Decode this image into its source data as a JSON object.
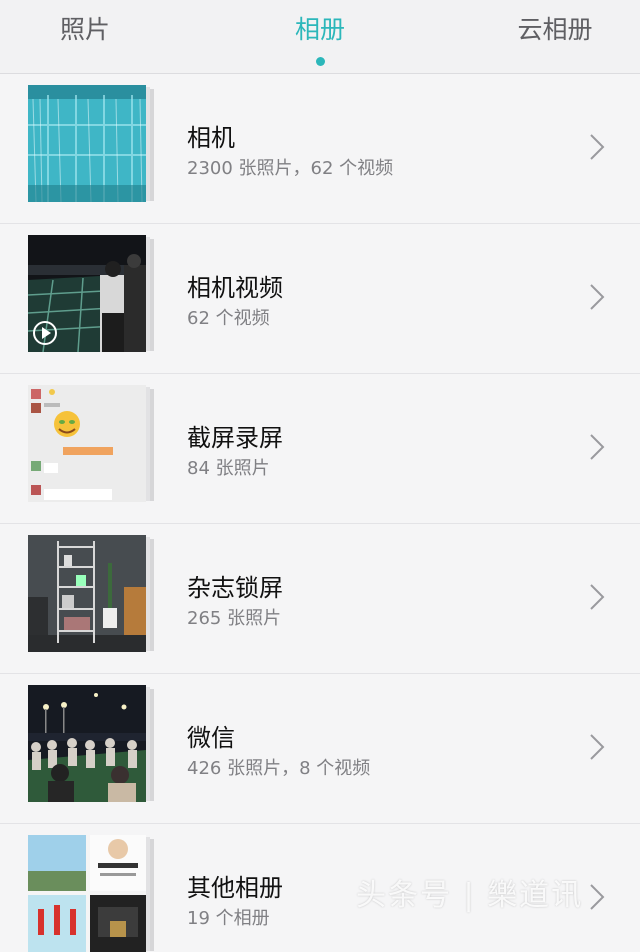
{
  "tabs": [
    {
      "label": "照片"
    },
    {
      "label": "相册"
    },
    {
      "label": "云相册"
    }
  ],
  "active_tab_color": "#2cb7ba",
  "albums": [
    {
      "title": "相机",
      "subtitle": "2300 张照片，62 个视频",
      "thumb_icon": "window-curtain-photo"
    },
    {
      "title": "相机视频",
      "subtitle": "62 个视频",
      "thumb_icon": "night-video-thumbnail"
    },
    {
      "title": "截屏录屏",
      "subtitle": "84 张照片",
      "thumb_icon": "chat-screenshot-thumbnail"
    },
    {
      "title": "杂志锁屏",
      "subtitle": "265 张照片",
      "thumb_icon": "interior-shelf-photo"
    },
    {
      "title": "微信",
      "subtitle": "426 张照片，8 个视频",
      "thumb_icon": "night-crowd-photo"
    },
    {
      "title": "其他相册",
      "subtitle": "19 个相册",
      "thumb_icon": "collage-thumbnail"
    }
  ],
  "watermark": "头条号 | 樂道讯"
}
